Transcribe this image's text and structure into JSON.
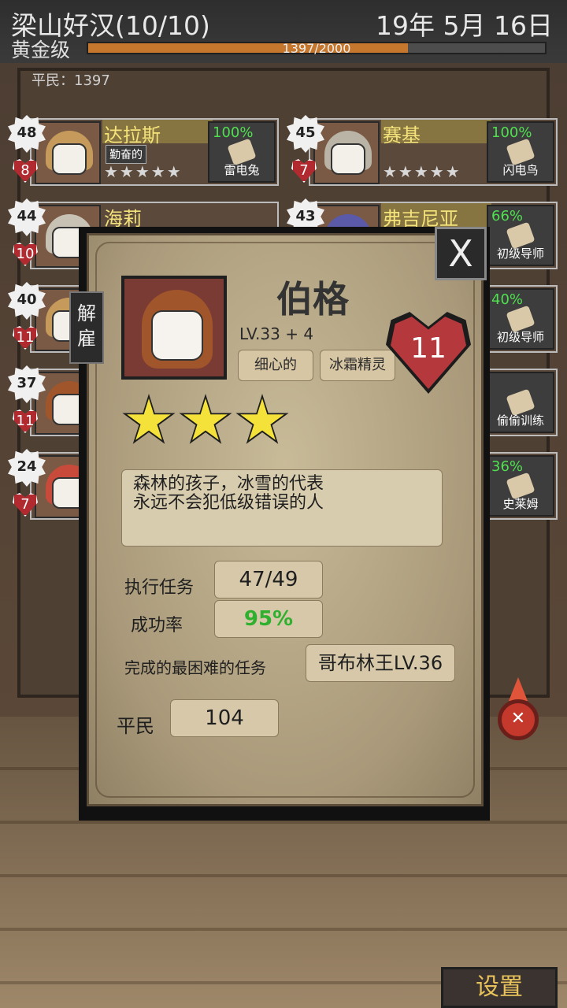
{
  "header": {
    "guild_name": "梁山好汉(10/10)",
    "guild_rank": "黄金级",
    "date": "19年 5月 16日",
    "xp_text": "1397/2000",
    "xp_fraction": 0.7
  },
  "board": {
    "commoners": "平民：1397"
  },
  "roster": [
    {
      "level": "48",
      "hp": "8",
      "name": "达拉斯",
      "trait": "勤奋的",
      "quest_pct": "100%",
      "quest": "雷电兔",
      "hair": "#c69a5a"
    },
    {
      "level": "45",
      "hp": "7",
      "name": "赛基",
      "trait": "",
      "quest_pct": "100%",
      "quest": "闪电鸟",
      "hair": "#b9b4a6"
    },
    {
      "level": "44",
      "hp": "10",
      "name": "海莉",
      "trait": "",
      "quest_pct": "",
      "quest": "",
      "hair": "#c7c2b4"
    },
    {
      "level": "43",
      "hp": "",
      "name": "弗吉尼亚",
      "trait": "",
      "quest_pct": "66%",
      "quest": "初级导师",
      "hair": "#5a5aa8"
    },
    {
      "level": "40",
      "hp": "11",
      "name": "",
      "trait": "",
      "quest_pct": "",
      "quest": "",
      "hair": "#c69a5a"
    },
    {
      "level": "",
      "hp": "",
      "name": "",
      "trait": "",
      "quest_pct": "40%",
      "quest": "初级导师",
      "hair": "#000"
    },
    {
      "level": "37",
      "hp": "11",
      "name": "",
      "trait": "",
      "quest_pct": "",
      "quest": "",
      "hair": "#a0552b"
    },
    {
      "level": "",
      "hp": "",
      "name": "",
      "trait": "",
      "quest_pct": "",
      "quest": "偷偷训练",
      "hair": "#000"
    },
    {
      "level": "24",
      "hp": "7",
      "name": "",
      "trait": "",
      "quest_pct": "",
      "quest": "",
      "hair": "#c84a3a"
    },
    {
      "level": "",
      "hp": "",
      "name": "",
      "trait": "",
      "quest_pct": "36%",
      "quest": "史莱姆",
      "hair": "#000"
    }
  ],
  "modal": {
    "close": "X",
    "fire": "解雇",
    "name": "伯格",
    "level": "LV.33 + 4",
    "trait1": "细心的",
    "trait2": "冰霜精灵",
    "hp": "11",
    "stars": 3,
    "description": "森林的孩子，冰雪的代表\n永远不会犯低级错误的人",
    "stats": {
      "missions_label": "执行任务",
      "missions_value": "47/49",
      "success_label": "成功率",
      "success_value": "95%",
      "hardest_label": "完成的最困难的任务",
      "hardest_value": "哥布林王LV.36",
      "commoner_label": "平民",
      "commoner_value": "104"
    }
  },
  "footer": {
    "settings": "设置"
  },
  "colors": {
    "accent_gold": "#f4e27a",
    "success_green": "#2fb02f",
    "xp_orange": "#c4772d",
    "heart_red": "#b5393c"
  }
}
